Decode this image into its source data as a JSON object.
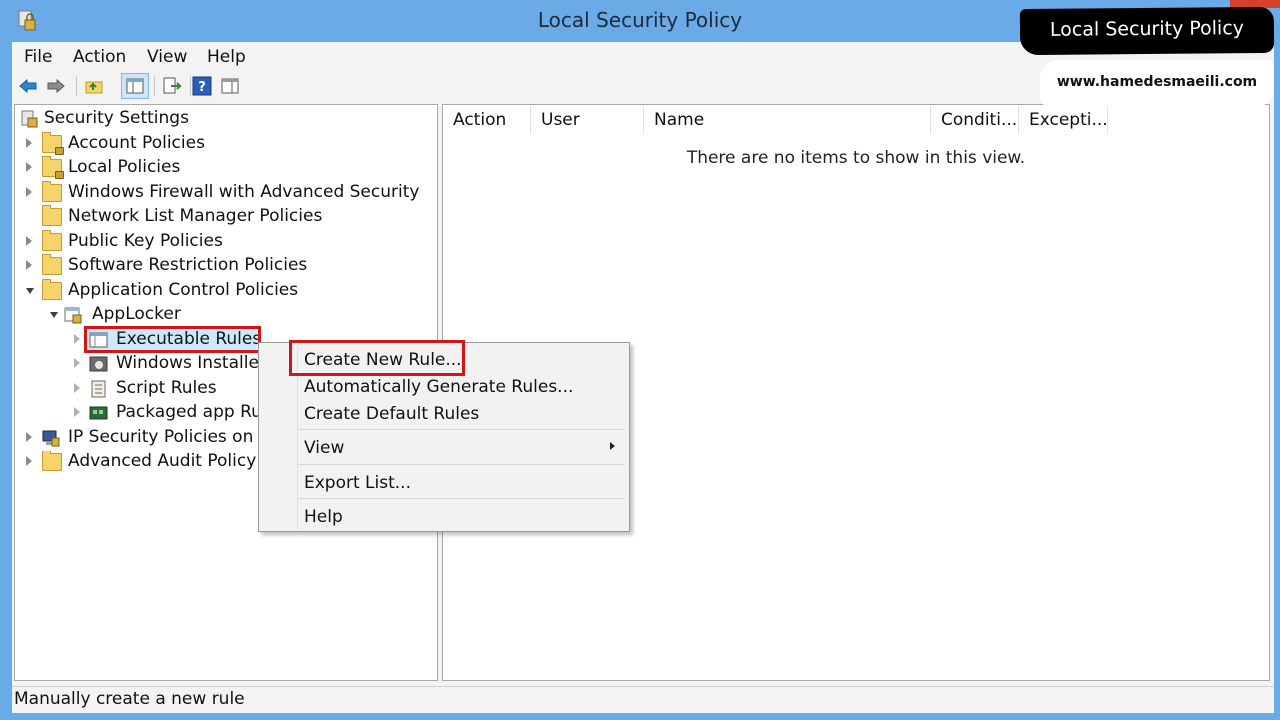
{
  "window": {
    "title": "Local Security Policy"
  },
  "menu": {
    "file": "File",
    "action": "Action",
    "view": "View",
    "help": "Help"
  },
  "toolbar": {
    "icons": [
      "back-arrow-icon",
      "forward-arrow-icon",
      "up-folder-icon",
      "show-tree-icon",
      "export-list-icon",
      "help-icon",
      "properties-pane-icon"
    ]
  },
  "tree": {
    "root": "Security Settings",
    "account_policies": "Account Policies",
    "local_policies": "Local Policies",
    "windows_firewall": "Windows Firewall with Advanced Security",
    "network_list": "Network List Manager Policies",
    "public_key": "Public Key Policies",
    "software_restriction": "Software Restriction Policies",
    "application_control": "Application Control Policies",
    "applocker": "AppLocker",
    "executable_rules": "Executable Rules",
    "windows_installer": "Windows Installe",
    "script_rules": "Script Rules",
    "packaged_app": "Packaged app Ru",
    "ip_security": "IP Security Policies on L",
    "advanced_audit": "Advanced Audit Policy"
  },
  "list": {
    "columns": [
      "Action",
      "User",
      "Name",
      "Conditi...",
      "Excepti..."
    ],
    "empty_message": "There are no items to show in this view."
  },
  "context_menu": {
    "create_new_rule": "Create New Rule...",
    "auto_generate": "Automatically Generate Rules...",
    "create_default": "Create Default Rules",
    "view": "View",
    "export_list": "Export List...",
    "help": "Help"
  },
  "status": {
    "text": "Manually create a new rule"
  },
  "watermark": {
    "label": "Local Security Policy",
    "url": "www.hamedesmaeili.com"
  },
  "colors": {
    "titlebar": "#6aaae6",
    "highlight": "#d01616",
    "selection": "#cde8fb"
  }
}
